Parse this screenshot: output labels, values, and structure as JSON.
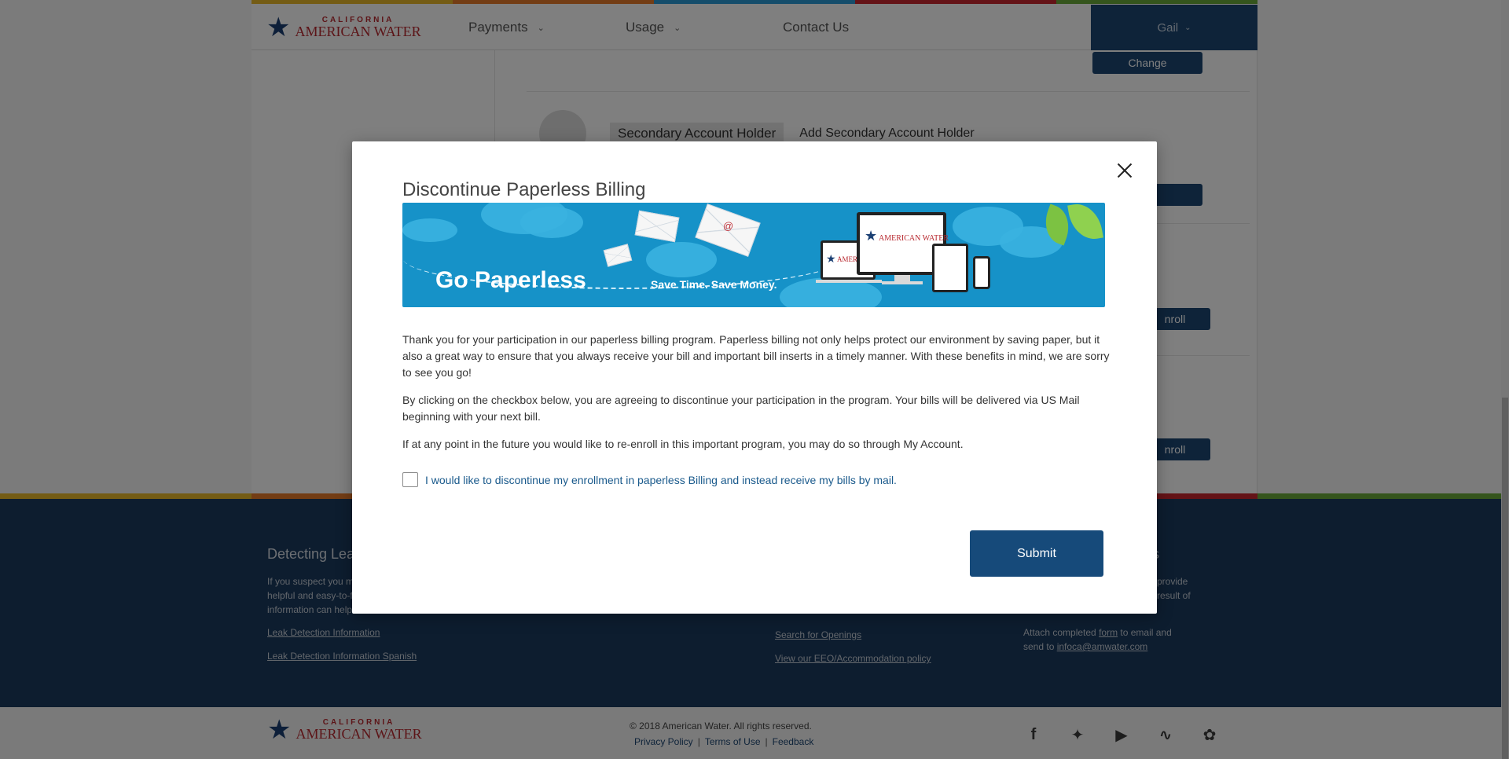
{
  "header": {
    "logo_state": "CALIFORNIA",
    "logo_name": "AMERICAN WATER",
    "nav": [
      {
        "label": "Payments"
      },
      {
        "label": "Usage"
      },
      {
        "label": "Contact Us"
      }
    ],
    "user_name": "Gail"
  },
  "background": {
    "change_button": "Change",
    "secondary_holder_label": "Secondary Account Holder",
    "add_secondary_link": "Add Secondary Account Holder",
    "enroll_button_1": "nroll",
    "enroll_button_2": "nroll"
  },
  "modal": {
    "title": "Discontinue Paperless Billing",
    "banner": {
      "heading": "Go Paperless",
      "tagline": "Save Time. Save Money.",
      "device_brand": "AMERICAN WATER",
      "device_brand_short": "AMERICAN W"
    },
    "paragraphs": [
      "Thank you for your participation in our paperless billing program. Paperless billing not only helps protect our environment by saving paper, but it also a great way to ensure that you always receive your bill and important bill inserts in a timely manner. With these benefits in mind, we are sorry to see you go!",
      "By clicking on the checkbox below, you are agreeing to discontinue your participation in the program. Your bills will be delivered via US Mail beginning with your next bill.",
      "If at any point in the future you would like to re-enroll in this important program, you may do so through My Account."
    ],
    "checkbox_label": "I would like to discontinue my enrollment in paperless Billing and instead receive my bills by mail.",
    "submit_label": "Submit"
  },
  "footer": {
    "col1_title": "Detecting Lea",
    "col1_text_1": "If you suspect you m",
    "col1_text_2": "helpful and easy-to-f",
    "col1_text_3": "information can help",
    "col1_link_1": "Leak Detection Information",
    "col1_link_2": "Leak Detection Information Spanish",
    "col3_link_1": "Search for Openings",
    "col3_link_2": "View our EEO/Accommodation policy",
    "col4_title": "s",
    "col4_text_1": "provide",
    "col4_text_2": "result of",
    "col4_attach_pre": "Attach completed ",
    "col4_attach_link": "form",
    "col4_attach_post": " to email and",
    "col4_send_pre": "send to ",
    "col4_email": "infoca@amwater.com"
  },
  "bottom": {
    "copyright": "© 2018 American Water. All rights reserved.",
    "privacy": "Privacy Policy",
    "terms": "Terms of Use",
    "feedback": "Feedback",
    "separator": "|"
  },
  "colors": {
    "brand_navy": "#1c4673",
    "brand_red": "#b8282f",
    "footer_bg": "#1b3a5e",
    "banner_blue": "#1692c8",
    "stripe": [
      "#e8b82a",
      "#e77a2a",
      "#2a9bd7",
      "#c8262e",
      "#6aab3b"
    ]
  },
  "icons": {
    "social": [
      "facebook-icon",
      "twitter-icon",
      "youtube-icon",
      "rss-icon",
      "duck-icon"
    ]
  }
}
